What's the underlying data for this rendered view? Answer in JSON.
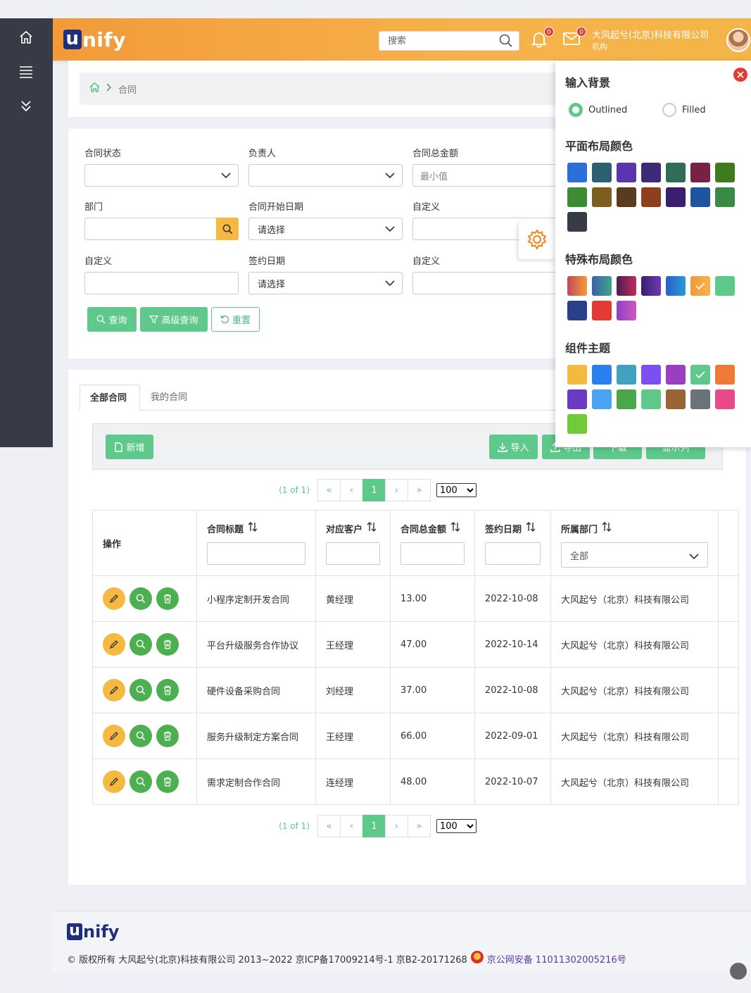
{
  "app": {
    "logo_u": "u",
    "logo_rest": "nify"
  },
  "header": {
    "search_placeholder": "搜索",
    "notif_count": "0",
    "mail_count": "0",
    "company": "大风起兮(北京)科技有限公司",
    "company_sub": "机构"
  },
  "breadcrumb": {
    "current": "合同"
  },
  "filters": {
    "status_label": "合同状态",
    "owner_label": "负责人",
    "amount_label": "合同总金额",
    "amount_min_placeholder": "最小值",
    "dept_label": "部门",
    "start_label": "合同开始日期",
    "start_value": "请选择",
    "custom1_label": "自定义",
    "custom2_label": "自定义",
    "sign_label": "签约日期",
    "sign_value": "请选择",
    "custom3_label": "自定义",
    "query_btn": "查询",
    "advanced_btn": "高级查询",
    "reset_btn": "重置"
  },
  "tabs": [
    "全部合同",
    "我的合同"
  ],
  "toolbar": {
    "add": "新增",
    "import": "导入",
    "export": "导出",
    "download": "下载",
    "display": "显示列"
  },
  "pager": {
    "info": "(1 of 1)",
    "page": "1",
    "page_size": "100",
    "page_size_options": [
      "100"
    ]
  },
  "table": {
    "headers": {
      "actions": "操作",
      "title": "合同标题",
      "customer": "对应客户",
      "amount": "合同总金额",
      "sign_date": "签约日期",
      "dept": "所属部门",
      "dept_filter": "全部"
    },
    "rows": [
      {
        "title": "小程序定制开发合同",
        "customer": "黄经理",
        "amount": "13.00",
        "date": "2022-10-08",
        "dept": "大风起兮（北京）科技有限公司"
      },
      {
        "title": "平台升级服务合作协议",
        "customer": "王经理",
        "amount": "47.00",
        "date": "2022-10-14",
        "dept": "大风起兮（北京）科技有限公司"
      },
      {
        "title": "硬件设备采购合同",
        "customer": "刘经理",
        "amount": "37.00",
        "date": "2022-10-08",
        "dept": "大风起兮（北京）科技有限公司"
      },
      {
        "title": "服务升级制定方案合同",
        "customer": "王经理",
        "amount": "66.00",
        "date": "2022-09-01",
        "dept": "大风起兮（北京）科技有限公司"
      },
      {
        "title": "需求定制合作合同",
        "customer": "连经理",
        "amount": "48.00",
        "date": "2022-10-07",
        "dept": "大风起兮（北京）科技有限公司"
      }
    ]
  },
  "settings": {
    "input_bg_title": "输入背景",
    "outlined": "Outlined",
    "filled": "Filled",
    "flat_title": "平面布局颜色",
    "flat_colors": [
      "#2a6fdb",
      "#2d5f73",
      "#5b35b0",
      "#3e2a78",
      "#2f6e55",
      "#7a1f45",
      "#3f7a1c",
      "#3d8b35",
      "#7c5e1f",
      "#5a3b1f",
      "#8e3f1e",
      "#3a1f6e",
      "#1f55a0",
      "#3a8a45",
      "#363b45"
    ],
    "special_title": "特殊布局颜色",
    "special_gradients": [
      [
        "#c2475c",
        "#f29a3a"
      ],
      [
        "#3e5fa8",
        "#3fa58a"
      ],
      [
        "#4a1f55",
        "#c22a5a"
      ],
      [
        "#3a1f6e",
        "#6a3ab3"
      ],
      [
        "#2a5fc2",
        "#2a9ad8"
      ],
      [
        "#f29a3a",
        "#f6b24a"
      ],
      [
        "#5fc98c",
        "#5fc98c"
      ],
      [
        "#2a3f8a",
        "#2a3f8a"
      ],
      [
        "#e53935",
        "#e53935"
      ],
      [
        "#8e3fc2",
        "#d05ac0"
      ]
    ],
    "special_selected": 5,
    "theme_title": "组件主题",
    "theme_colors": [
      "#f5b942",
      "#2a7ff0",
      "#3fa3c0",
      "#7c4ff0",
      "#9a3fc0",
      "#5fc98c",
      "#f07a35",
      "#6a3ac2",
      "#4aa3f0",
      "#4aa84a",
      "#5fc98c",
      "#9a6535",
      "#6a727c",
      "#e84a8a",
      "#72c93a"
    ],
    "theme_selected": 5
  },
  "footer": {
    "copyright": "© 版权所有 大风起兮(北京)科技有限公司 2013~2022 京ICP备17009214号-1 京B2-20171268",
    "police": "京公网安备 11011302005216号"
  }
}
